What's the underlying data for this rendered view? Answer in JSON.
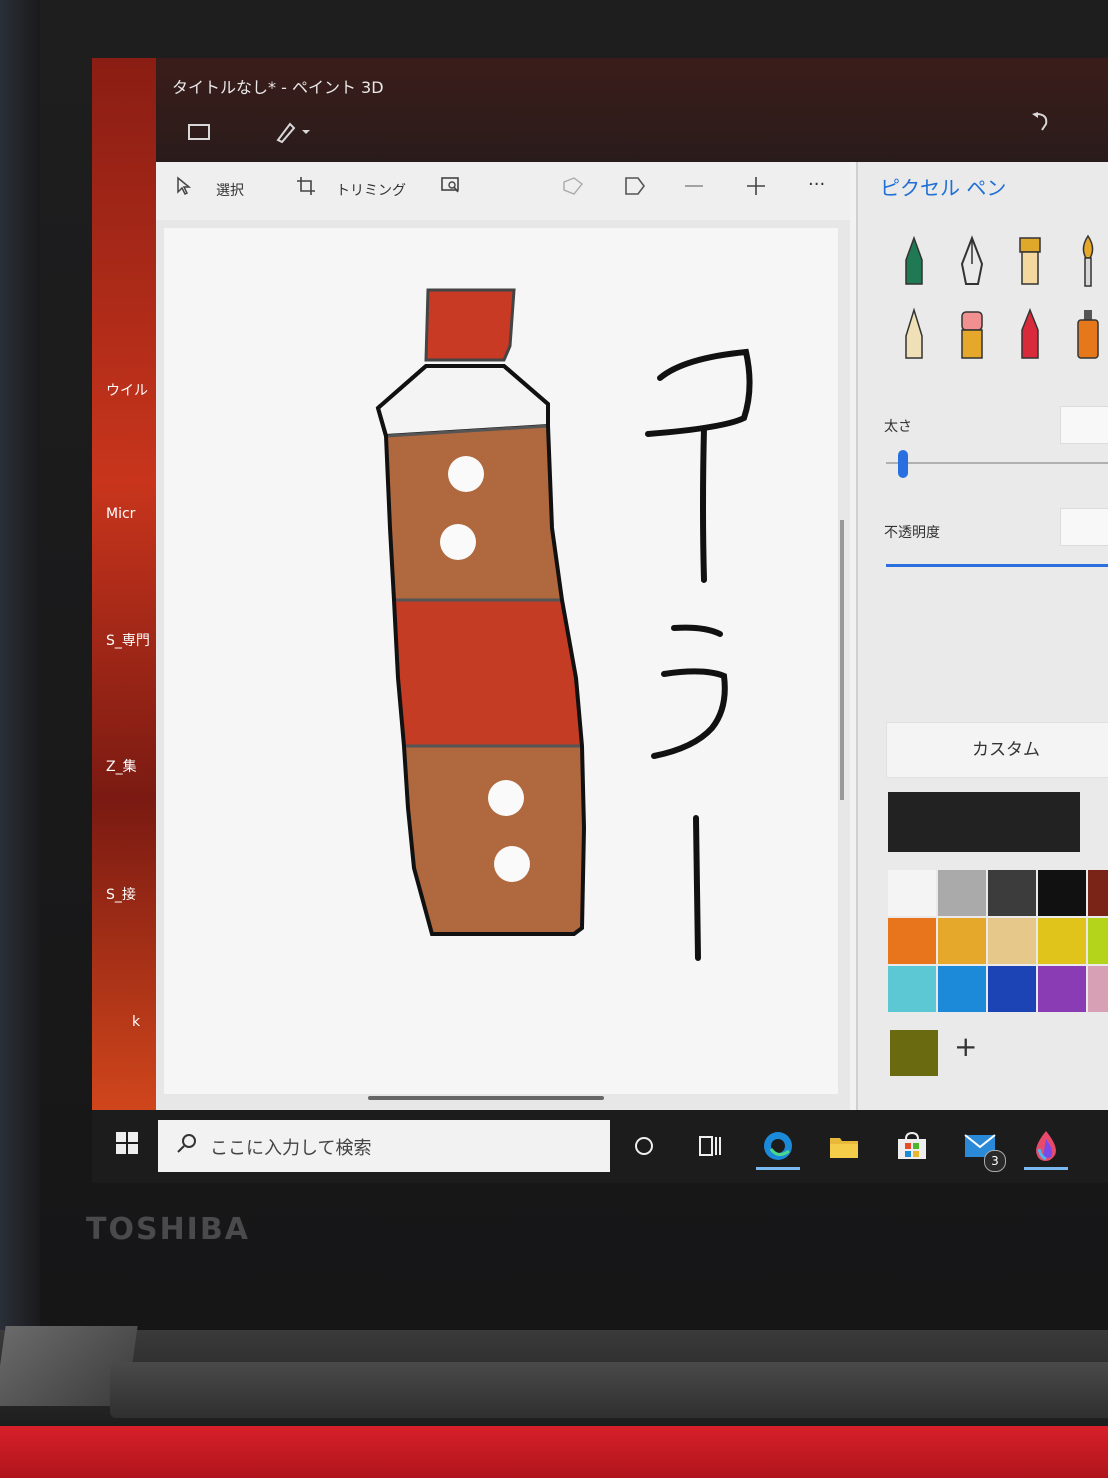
{
  "device": {
    "brand": "TOSHIBA"
  },
  "desktop": {
    "icons": [
      "ウイル",
      "Micr",
      "S_専門",
      "Z_集",
      "S_接",
      "k"
    ]
  },
  "window": {
    "title": "タイトルなし* - ペイント 3D",
    "menu_icon": "folder-icon",
    "brush_menu_icon": "brush-dropdown-icon",
    "undo_icon": "undo-icon"
  },
  "toolbar": {
    "select_label": "選択",
    "trim_label": "トリミング",
    "more_label": "···"
  },
  "drawing": {
    "text_chars": [
      "ア",
      "ラ",
      "ー"
    ],
    "colors": {
      "cap": "#c83a24",
      "label_brown": "#b0683f",
      "band_red": "#c43c24",
      "outline": "#111111"
    }
  },
  "panel": {
    "title": "ピクセル ペン",
    "brushes": [
      "marker-icon",
      "calligraphy-pen-icon",
      "oil-brush-icon",
      "watercolor-icon",
      "pencil-icon",
      "eraser-icon",
      "crayon-icon",
      "spray-can-icon"
    ],
    "thickness_label": "太さ",
    "thickness_value": "5",
    "opacity_label": "不透明度",
    "custom_label": "カスタム",
    "current_color": "#222222",
    "swatches": [
      "#f4f4f4",
      "#aaaaaa",
      "#3c3c3c",
      "#111111",
      "#7a2418",
      "#e8741c",
      "#e6a82a",
      "#e6c98a",
      "#e0c41c",
      "#b4d41c",
      "#5cc8d4",
      "#1c8ad8",
      "#1c44b4",
      "#8a3cb4",
      "#d8a0b4"
    ],
    "extra_swatch": "#6a6a10",
    "add_label": "+"
  },
  "taskbar": {
    "search_placeholder": "ここに入力して検索",
    "mail_badge": "3",
    "apps": [
      "cortana-icon",
      "task-view-icon",
      "edge-icon",
      "file-explorer-icon",
      "store-icon",
      "mail-icon",
      "paint3d-icon"
    ]
  }
}
